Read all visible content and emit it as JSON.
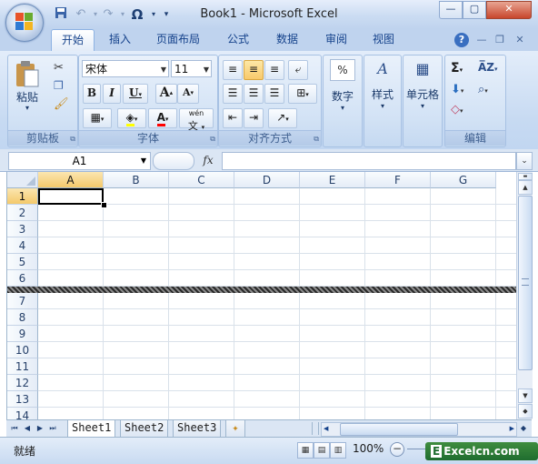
{
  "window": {
    "title": "Book1 - Microsoft Excel"
  },
  "qat": {
    "save": "save-icon",
    "undo": "undo-icon",
    "redo": "redo-icon",
    "symbol": "Ω",
    "customize": "customize-qat-icon"
  },
  "tabs": [
    {
      "label": "开始"
    },
    {
      "label": "插入"
    },
    {
      "label": "页面布局"
    },
    {
      "label": "公式"
    },
    {
      "label": "数据"
    },
    {
      "label": "审阅"
    },
    {
      "label": "视图"
    }
  ],
  "ribbon": {
    "clipboard": {
      "label": "剪贴板",
      "paste": "粘贴"
    },
    "font": {
      "label": "字体",
      "name": "宋体",
      "size": "11",
      "bold": "B",
      "italic": "I",
      "underline": "U",
      "grow": "A",
      "shrink": "A",
      "phonetic_top": "wén",
      "phonetic": "文"
    },
    "alignment": {
      "label": "对齐方式"
    },
    "number": {
      "label": "数字",
      "symbol": "%"
    },
    "styles": {
      "label": "样式"
    },
    "cells": {
      "label": "单元格"
    },
    "editing": {
      "label": "编辑",
      "sum": "Σ"
    }
  },
  "formula_bar": {
    "name_box": "A1",
    "fx": "fx",
    "content": ""
  },
  "grid": {
    "columns": [
      "A",
      "B",
      "C",
      "D",
      "E",
      "F",
      "G"
    ],
    "rows": [
      "1",
      "2",
      "3",
      "4",
      "5",
      "6",
      "7",
      "8",
      "9",
      "10",
      "11",
      "12",
      "13",
      "14"
    ],
    "active_cell": "A1"
  },
  "sheets": [
    {
      "label": "Sheet1"
    },
    {
      "label": "Sheet2"
    },
    {
      "label": "Sheet3"
    }
  ],
  "status": {
    "text": "就绪",
    "zoom": "100%"
  },
  "watermark": "Excelcn.com",
  "colors": {
    "ribbon": "#c7daf2",
    "accent_tab": "#8db2e3",
    "selected_header": "#f4c96b",
    "text": "#15428b"
  }
}
